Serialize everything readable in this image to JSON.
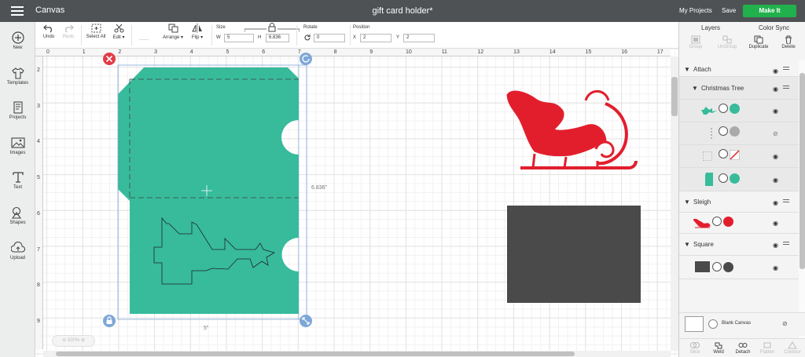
{
  "topbar": {
    "app_name": "Canvas",
    "doc_title": "gift card holder*",
    "my_projects": "My Projects",
    "save": "Save",
    "make_it": "Make It"
  },
  "left_nav": [
    {
      "label": "New",
      "icon": "plus-circle-icon"
    },
    {
      "label": "Templates",
      "icon": "shirt-icon"
    },
    {
      "label": "Projects",
      "icon": "projects-icon"
    },
    {
      "label": "Images",
      "icon": "images-icon"
    },
    {
      "label": "Text",
      "icon": "text-icon"
    },
    {
      "label": "Shapes",
      "icon": "shapes-icon"
    },
    {
      "label": "Upload",
      "icon": "upload-icon"
    }
  ],
  "toolbar": {
    "undo": "Undo",
    "redo": "Redo",
    "select_all": "Select All",
    "edit": "Edit",
    "arrange": "Arrange",
    "flip": "Flip",
    "size_label": "Size",
    "w_label": "W",
    "w_value": "5",
    "h_label": "H",
    "h_value": "6.836",
    "rotate_label": "Rotate",
    "rotate_value": "0",
    "position_label": "Position",
    "x_label": "X",
    "x_value": "2",
    "y_label": "Y",
    "y_value": "2"
  },
  "ruler": {
    "h_ticks": [
      "0",
      "1",
      "2",
      "3",
      "4",
      "5",
      "6",
      "7",
      "8",
      "9",
      "10",
      "11",
      "12",
      "13",
      "14",
      "15",
      "16",
      "17"
    ],
    "v_ticks": [
      "2",
      "3",
      "4",
      "5",
      "6",
      "7",
      "8",
      "9"
    ]
  },
  "canvas": {
    "height_label": "6.836\"",
    "width_label": "5\"",
    "zoom": "100%",
    "colors": {
      "card": "#37bb9b",
      "sleigh": "#e21e2d",
      "square": "#4a4a4a",
      "selection": "#7ea7d8"
    }
  },
  "layers": {
    "tab_layers": "Layers",
    "tab_color_sync": "Color Sync",
    "tools": {
      "group": "Group",
      "ungroup": "UnGroup",
      "duplicate": "Duplicate",
      "delete": "Delete"
    },
    "attach_label": "Attach",
    "christmas_tree_label": "Christmas Tree",
    "sleigh_label": "Sleigh",
    "square_label": "Square",
    "blank_canvas": "Blank Canvas",
    "bottom_tools": {
      "slice": "Slice",
      "weld": "Weld",
      "attach": "Detach",
      "flatten": "Flatten",
      "contour": "Contour"
    }
  }
}
